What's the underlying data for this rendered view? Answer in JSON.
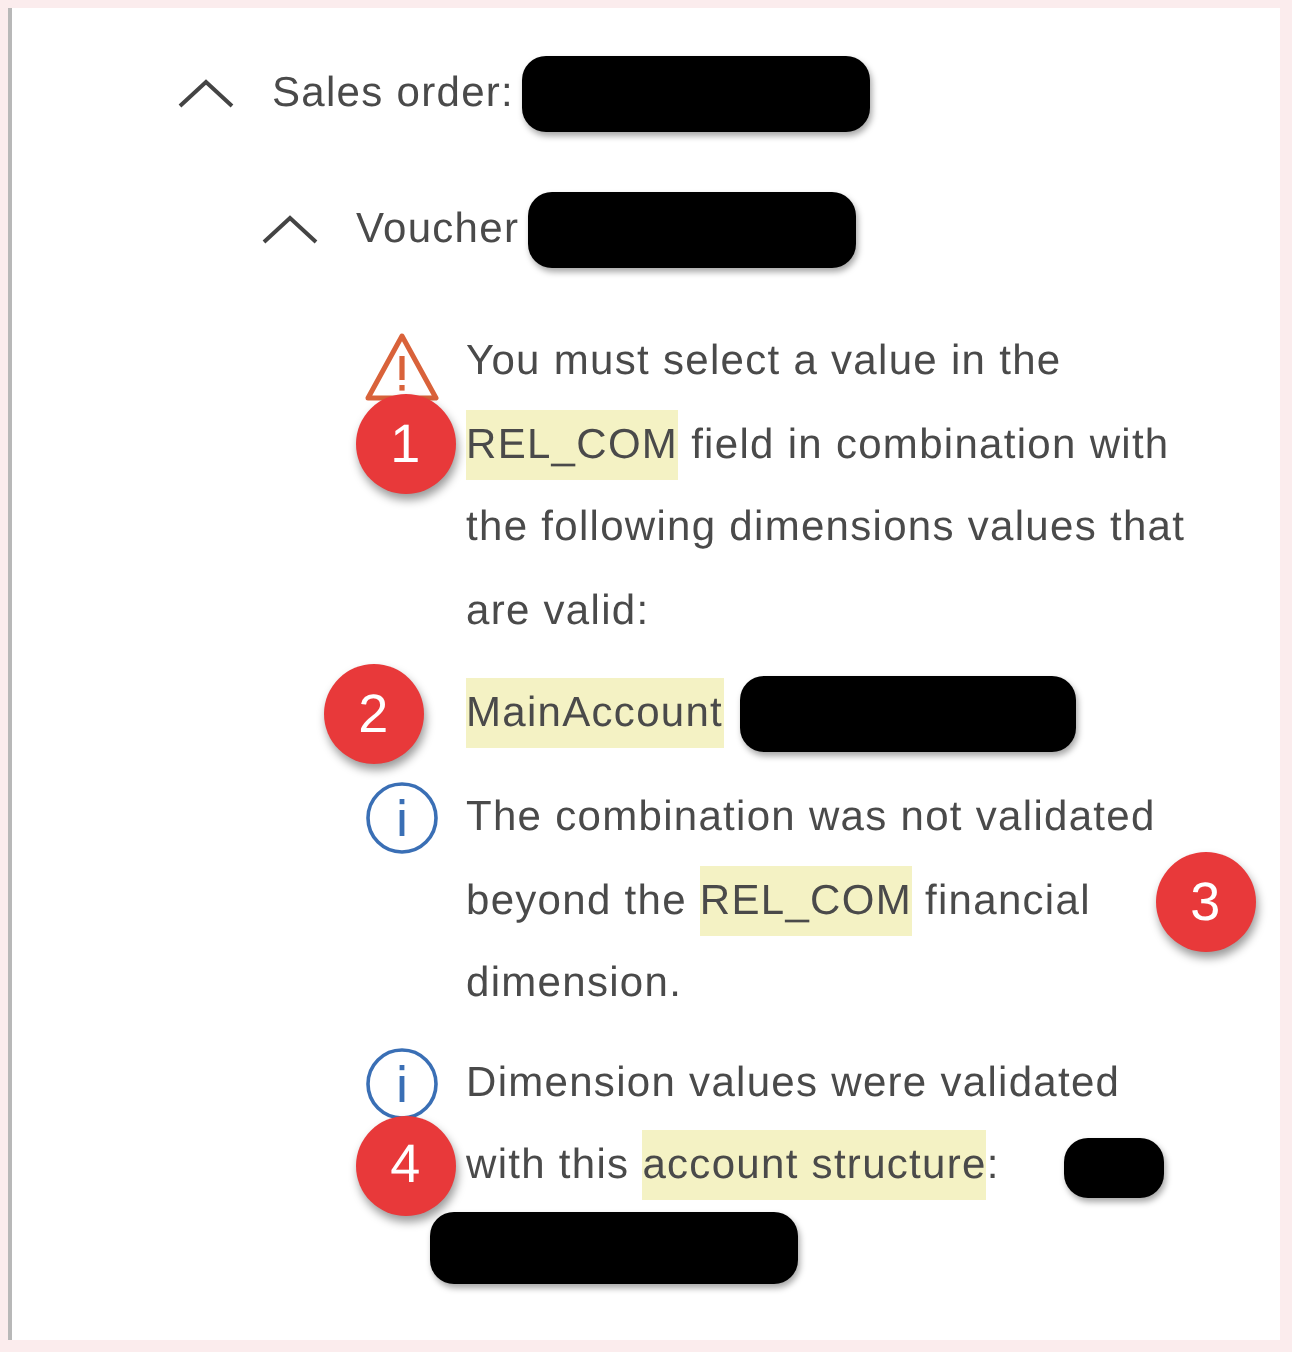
{
  "tree": {
    "label": "Sales order:",
    "expanded": true,
    "redacted": true,
    "children": [
      {
        "label": "Voucher",
        "expanded": true,
        "redacted": true,
        "messages": [
          {
            "kind": "warning",
            "badge": {
              "number": "1",
              "kind": "left"
            },
            "segments": [
              {
                "text": "You must select a value in the ",
                "highlighted": false
              },
              {
                "text": "REL_COM",
                "highlighted": true
              },
              {
                "text": " field in combination with the following dimensions values that are valid:",
                "highlighted": false
              }
            ]
          },
          {
            "kind": "value",
            "badge": {
              "number": "2",
              "kind": "left"
            },
            "redacted": true,
            "segments": [
              {
                "text": "MainAccount",
                "highlighted": true
              }
            ]
          },
          {
            "kind": "info",
            "badge": {
              "number": "3",
              "kind": "right"
            },
            "segments": [
              {
                "text": "The combination was not validated beyond the ",
                "highlighted": false
              },
              {
                "text": "REL_COM",
                "highlighted": true
              },
              {
                "text": " financial dimension.",
                "highlighted": false
              }
            ]
          },
          {
            "kind": "info",
            "badge": {
              "number": "4",
              "kind": "left"
            },
            "redacted": true,
            "segments": [
              {
                "text": "Dimension values were validated with this ",
                "highlighted": false
              },
              {
                "text": "account structure",
                "highlighted": true
              },
              {
                "text": ":",
                "highlighted": false
              }
            ]
          }
        ]
      }
    ]
  }
}
